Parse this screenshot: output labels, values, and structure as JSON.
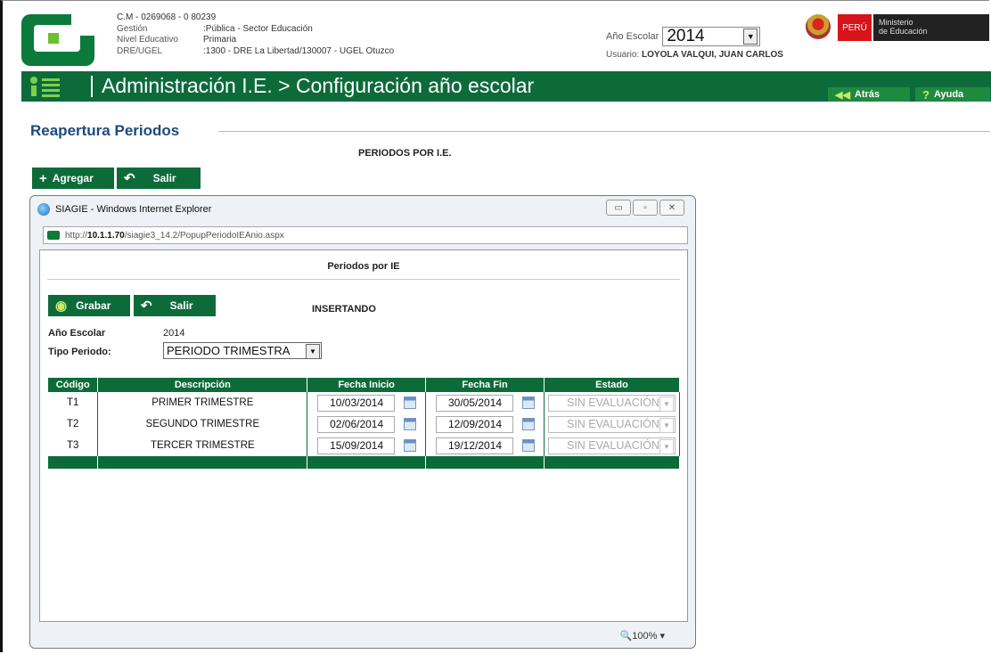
{
  "header": {
    "code": "C.M - 0269068 - 0  80239",
    "rows": [
      {
        "k": "Gestión",
        "v": ":Pública - Sector Educación"
      },
      {
        "k": "Nivel Educativo",
        "v": "Primaria"
      },
      {
        "k": "DRE/UGEL",
        "v": ":1300 - DRE La Libertad/130007 - UGEL Otuzco"
      }
    ],
    "anio_label": "Año Escolar",
    "anio_value": "2014",
    "usuario_label": "Usuario:",
    "usuario_value": "LOYOLA VALQUI, JUAN CARLOS",
    "peru": "PERÚ",
    "ministerio_1": "Ministerio",
    "ministerio_2": "de Educación"
  },
  "nav": {
    "title": "Administración I.E. > Configuración año escolar",
    "back": "Atrás",
    "help": "Ayuda"
  },
  "section": {
    "title": "Reapertura Periodos",
    "subtitle": "PERIODOS POR I.E.",
    "add": "Agregar",
    "exit": "Salir"
  },
  "popup": {
    "window_title": "SIAGIE - Windows Internet Explorer",
    "url_prefix": "http://",
    "url_host": "10.1.1.70",
    "url_path": "/siagie3_14.2/PopupPeriodoIEAnio.aspx",
    "heading": "Periodos por IE",
    "save": "Grabar",
    "exit": "Salir",
    "mode": "INSERTANDO",
    "anio_label": "Año Escolar",
    "anio_value": "2014",
    "tipo_label": "Tipo Periodo:",
    "tipo_value": "PERIODO TRIMESTRA",
    "zoom": "100%",
    "columns": [
      "Código",
      "Descripción",
      "Fecha Inicio",
      "Fecha Fin",
      "Estado"
    ],
    "rows": [
      {
        "codigo": "T1",
        "descripcion": "PRIMER TRIMESTRE",
        "inicio": "10/03/2014",
        "fin": "30/05/2014",
        "estado": "SIN EVALUACIÓN"
      },
      {
        "codigo": "T2",
        "descripcion": "SEGUNDO TRIMESTRE",
        "inicio": "02/06/2014",
        "fin": "12/09/2014",
        "estado": "SIN EVALUACIÓN"
      },
      {
        "codigo": "T3",
        "descripcion": "TERCER TRIMESTRE",
        "inicio": "15/09/2014",
        "fin": "19/12/2014",
        "estado": "SIN EVALUACIÓN"
      }
    ]
  },
  "colors": {
    "primary_green": "#0d6b3a",
    "title_blue": "#1c4a7a",
    "peru_red": "#d7141a"
  }
}
